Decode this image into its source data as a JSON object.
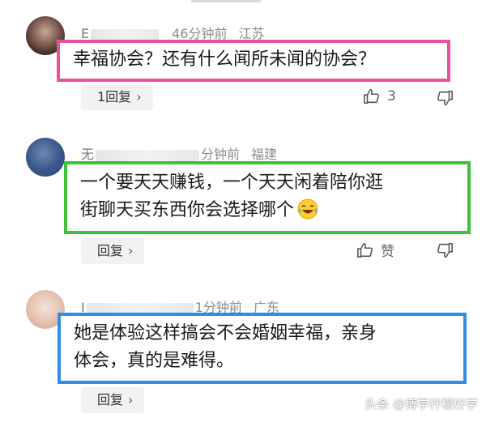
{
  "comments": [
    {
      "author": "E",
      "time": "46分钟前",
      "location": "江苏",
      "text_lines": [
        "幸福协会？还有什么闻所未闻的协会？"
      ],
      "reply_label": "1回复",
      "reply_chevron": "›",
      "like_count": "3",
      "box_color": "#e9509d"
    },
    {
      "author": "无",
      "time": "分钟前",
      "location": "福建",
      "text_lines": [
        "一个要天天赚钱，一个天天闲着陪你逛",
        "街聊天买东西你会选择哪个"
      ],
      "reply_label": "回复",
      "reply_chevron": "›",
      "like_count": "赞",
      "box_color": "#3fc23a"
    },
    {
      "author": "I",
      "time": "1分钟前",
      "location": "广东",
      "text_lines": [
        "她是体验这样搞会不会婚姻幸福，亲身",
        "体会，真的是难得。"
      ],
      "reply_label": "回复",
      "reply_chevron": "›",
      "box_color": "#2f8de4"
    }
  ],
  "watermark": "头条 @博学柠檬好学"
}
